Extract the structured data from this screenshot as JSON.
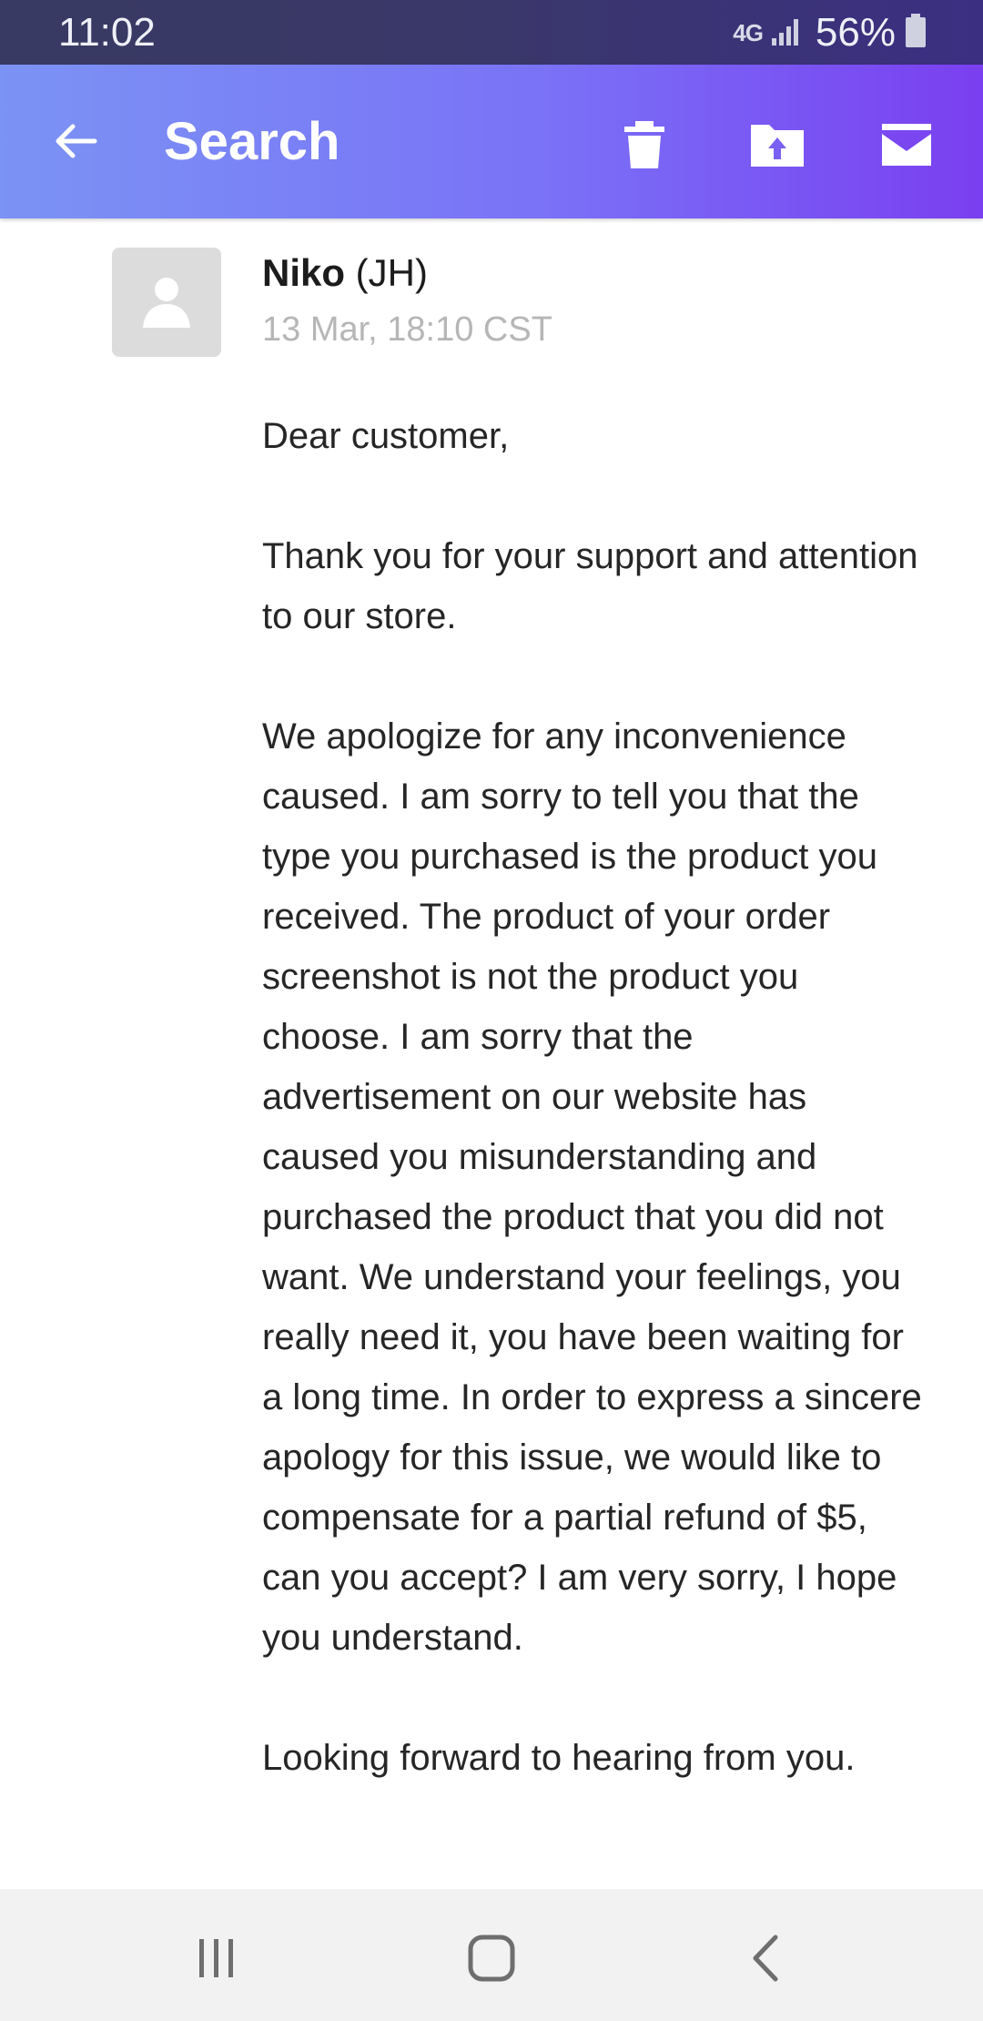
{
  "status_bar": {
    "time": "11:02",
    "network_label": "4G",
    "battery_percent": "56%"
  },
  "app_bar": {
    "title": "Search",
    "icons": [
      "back-arrow-icon",
      "trash-icon",
      "move-to-folder-icon",
      "archive-icon"
    ]
  },
  "message": {
    "sender_name": "Niko",
    "sender_suffix": " (JH)",
    "timestamp": "13 Mar, 18:10 CST",
    "paragraphs": [
      "Dear customer,",
      "Thank you for your support and attention to our store.",
      "We apologize for any inconvenience caused. I am sorry to tell you that the type you purchased is the product you received. The product of your order screenshot is not the product you choose. I am sorry that the advertisement on our website has caused you misunderstanding and purchased the product that you did not want. We understand your feelings, you really need it, you have been waiting for a long time. In order to express a sincere apology for this issue, we would like to compensate for a partial refund of $5, can you accept? I am very sorry, I hope you understand.",
      "Looking forward to hearing from you."
    ]
  },
  "nav_bar": {
    "icons": [
      "recent-apps-icon",
      "home-icon",
      "back-icon"
    ]
  },
  "colors": {
    "status_bar": "#383a63",
    "app_bar_start": "#7b93f4",
    "app_bar_end": "#7a3ff0",
    "nav_bar": "#f2f2f2"
  }
}
